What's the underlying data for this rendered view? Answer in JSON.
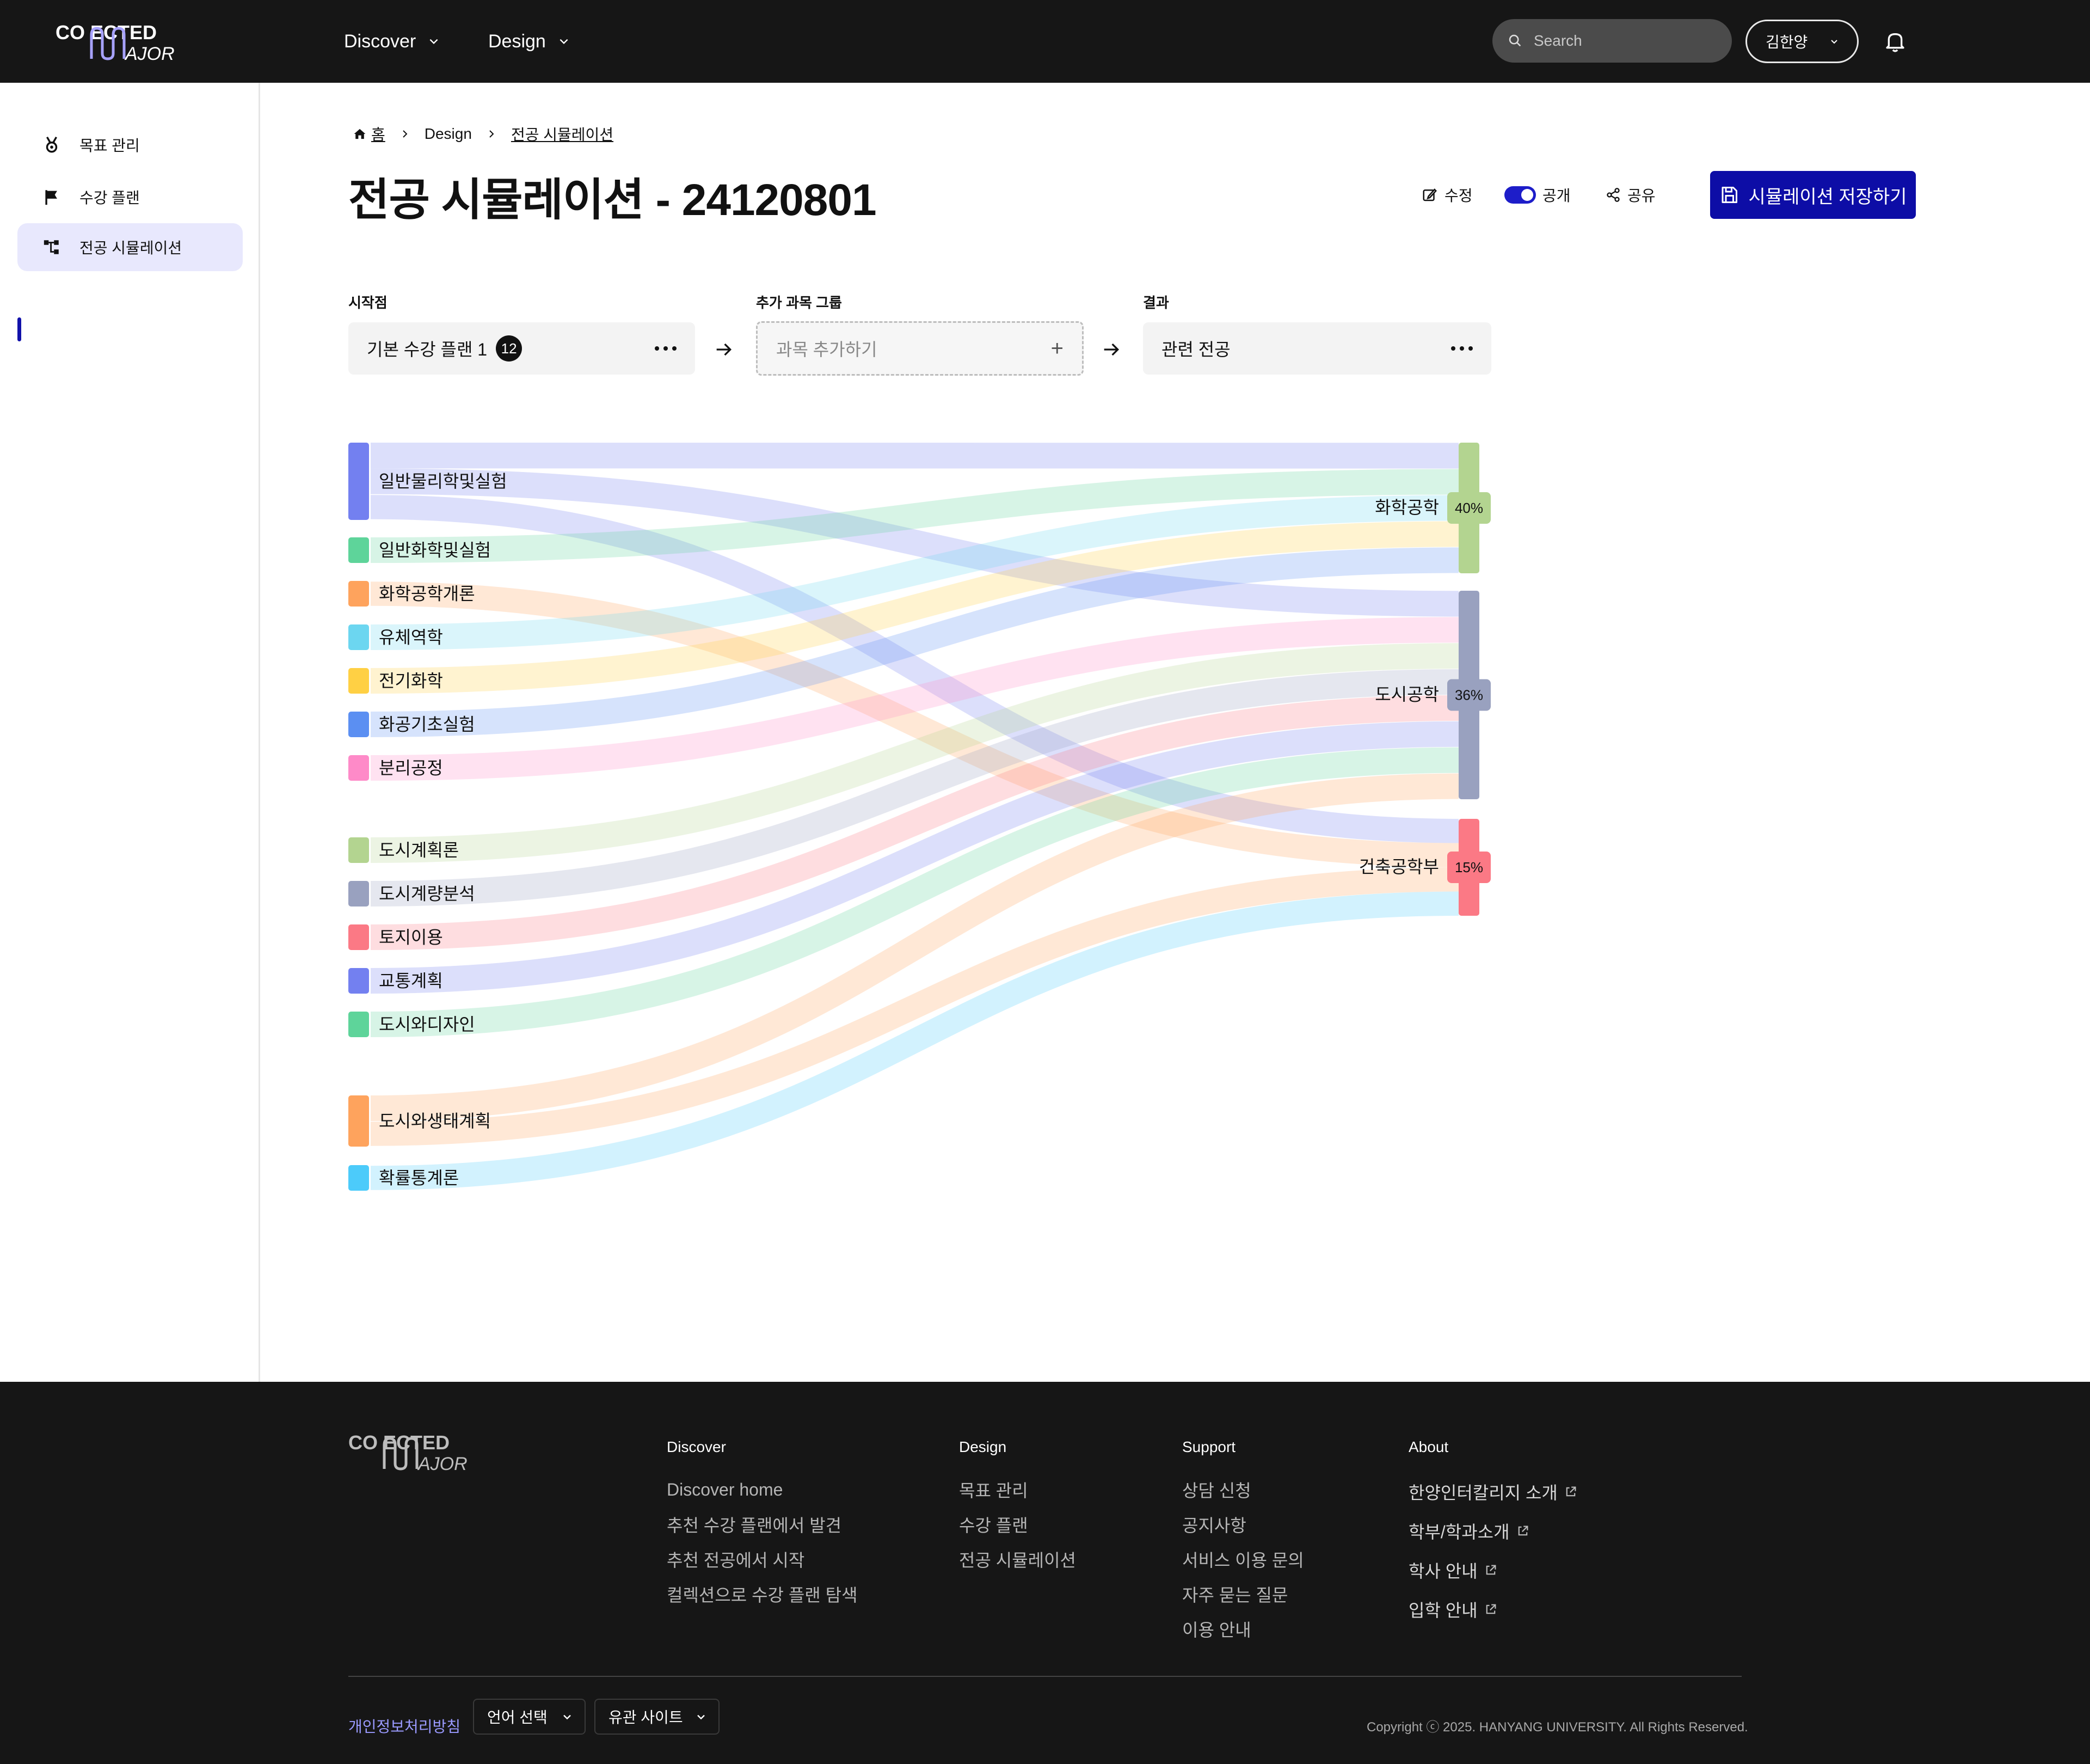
{
  "header": {
    "logo_top": "CO  ECTED",
    "logo_bottom": "AJOR",
    "nav": [
      {
        "label": "Discover"
      },
      {
        "label": "Design"
      }
    ],
    "search_placeholder": "Search",
    "user_name": "김한양"
  },
  "sidebar": {
    "items": [
      {
        "label": "목표 관리",
        "icon": "medal-icon"
      },
      {
        "label": "수강 플랜",
        "icon": "flag-icon"
      },
      {
        "label": "전공 시뮬레이션",
        "icon": "tree-icon",
        "active": true
      }
    ]
  },
  "breadcrumb": {
    "home": "홈",
    "section": "Design",
    "current": "전공 시뮬레이션"
  },
  "page": {
    "title": "전공 시뮬레이션 - 24120801",
    "actions": {
      "edit": "수정",
      "public": "공개",
      "share": "공유"
    },
    "public_on": true,
    "save_label": "시뮬레이션 저장하기"
  },
  "pipeline": {
    "start": {
      "label": "시작점",
      "value": "기본 수강 플랜 1",
      "count": "12"
    },
    "group": {
      "label": "추가 과목 그룹",
      "placeholder": "과목 추가하기"
    },
    "result": {
      "label": "결과",
      "value": "관련 전공"
    }
  },
  "colors": {
    "accent": "#0d0da6",
    "sources": [
      "#7380f0",
      "#5ed49a",
      "#fea35d",
      "#6cd6f0",
      "#ffd044",
      "#5b8ff2",
      "#fe8ac8",
      "#b3d490",
      "#99a1bf",
      "#fb7985",
      "#7380f0",
      "#5ed49a",
      "#fea35d",
      "#4ccbfa"
    ],
    "targets": [
      "#b3d490",
      "#99a1bf",
      "#fb7985"
    ]
  },
  "chart_data": {
    "type": "sankey",
    "sources": [
      "일반물리학및실험",
      "일반화학및실험",
      "화학공학개론",
      "유체역학",
      "전기화학",
      "화공기초실험",
      "분리공정",
      "도시계획론",
      "도시계량분석",
      "토지이용",
      "교통계획",
      "도시와디자인",
      "도시와생태계획",
      "확률통계론"
    ],
    "targets": [
      {
        "name": "화학공학",
        "percent": "40%"
      },
      {
        "name": "도시공학",
        "percent": "36%"
      },
      {
        "name": "건축공학부",
        "percent": "15%"
      }
    ],
    "links": [
      {
        "source": 0,
        "target": 0
      },
      {
        "source": 0,
        "target": 1
      },
      {
        "source": 0,
        "target": 2
      },
      {
        "source": 1,
        "target": 0
      },
      {
        "source": 2,
        "target": 2
      },
      {
        "source": 3,
        "target": 0
      },
      {
        "source": 4,
        "target": 0
      },
      {
        "source": 5,
        "target": 0
      },
      {
        "source": 6,
        "target": 1
      },
      {
        "source": 7,
        "target": 1
      },
      {
        "source": 8,
        "target": 1
      },
      {
        "source": 9,
        "target": 1
      },
      {
        "source": 10,
        "target": 1
      },
      {
        "source": 11,
        "target": 1
      },
      {
        "source": 12,
        "target": 1
      },
      {
        "source": 12,
        "target": 2
      },
      {
        "source": 13,
        "target": 2
      }
    ]
  },
  "footer": {
    "logo_top": "CO  ECTED",
    "logo_bottom": "AJOR",
    "columns": [
      {
        "title": "Discover",
        "links": [
          "Discover home",
          "추천 수강 플랜에서 발견",
          "추천 전공에서 시작",
          "컬렉션으로 수강 플랜 탐색"
        ]
      },
      {
        "title": "Design",
        "links": [
          "목표 관리",
          "수강 플랜",
          "전공 시뮬레이션"
        ]
      },
      {
        "title": "Support",
        "links": [
          "상담 신청",
          "공지사항",
          "서비스 이용 문의",
          "자주 묻는 질문",
          "이용 안내"
        ]
      },
      {
        "title": "About",
        "links": [
          "한양인터칼리지 소개",
          "학부/학과소개",
          "학사 안내",
          "입학 안내"
        ]
      }
    ],
    "privacy": "개인정보처리방침",
    "language": "언어 선택",
    "related": "유관 사이트",
    "copyright": "Copyright ⓒ 2025. HANYANG UNIVERSITY. All Rights Reserved."
  }
}
